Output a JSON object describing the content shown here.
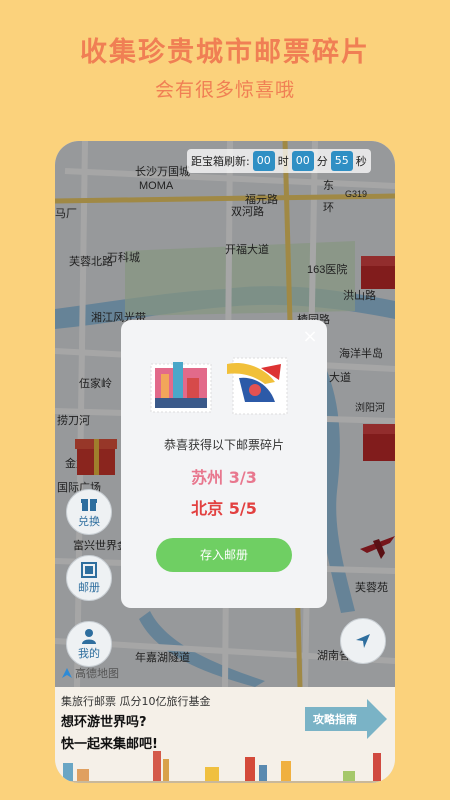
{
  "hero": {
    "title": "收集珍贵城市邮票碎片",
    "subtitle": "会有很多惊喜哦"
  },
  "timer": {
    "label": "距宝箱刷新:",
    "hours": "00",
    "h_unit": "时",
    "minutes": "00",
    "m_unit": "分",
    "seconds": "55",
    "s_unit": "秒"
  },
  "map": {
    "labels": [
      "长沙万国城",
      "MOMA",
      "福元路",
      "东",
      "环",
      "G319",
      "马厂",
      "芙蓉北路",
      "万科城",
      "双河路",
      "开福大道",
      "163医院",
      "洪山路",
      "湘江风光带",
      "楂园路",
      "海洋半岛",
      "伍家岭",
      "大道",
      "浏阳河",
      "金盆丘",
      "捞刀河",
      "国际广场",
      "富兴世界金融中心",
      "芙蓉苑",
      "年嘉湖隧道",
      "湖南省"
    ],
    "logo": "高德地图"
  },
  "sidebar": {
    "exchange": "兑换",
    "album": "邮册",
    "mine": "我的"
  },
  "modal": {
    "title": "恭喜获得以下邮票碎片",
    "fragments": [
      {
        "city": "苏州",
        "count": "3/3"
      },
      {
        "city": "北京",
        "count": "5/5"
      }
    ],
    "button": "存入邮册"
  },
  "banner": {
    "line1": "集旅行邮票 瓜分10亿旅行基金",
    "line2": "想环游世界吗?",
    "line3": "快一起来集邮吧!",
    "guide": "攻略指南"
  },
  "colors": {
    "accent": "#F07F54",
    "button": "#6FCF63",
    "timer_box": "#2f8fc4",
    "frag1": "#E8778E",
    "frag2": "#E24040"
  }
}
